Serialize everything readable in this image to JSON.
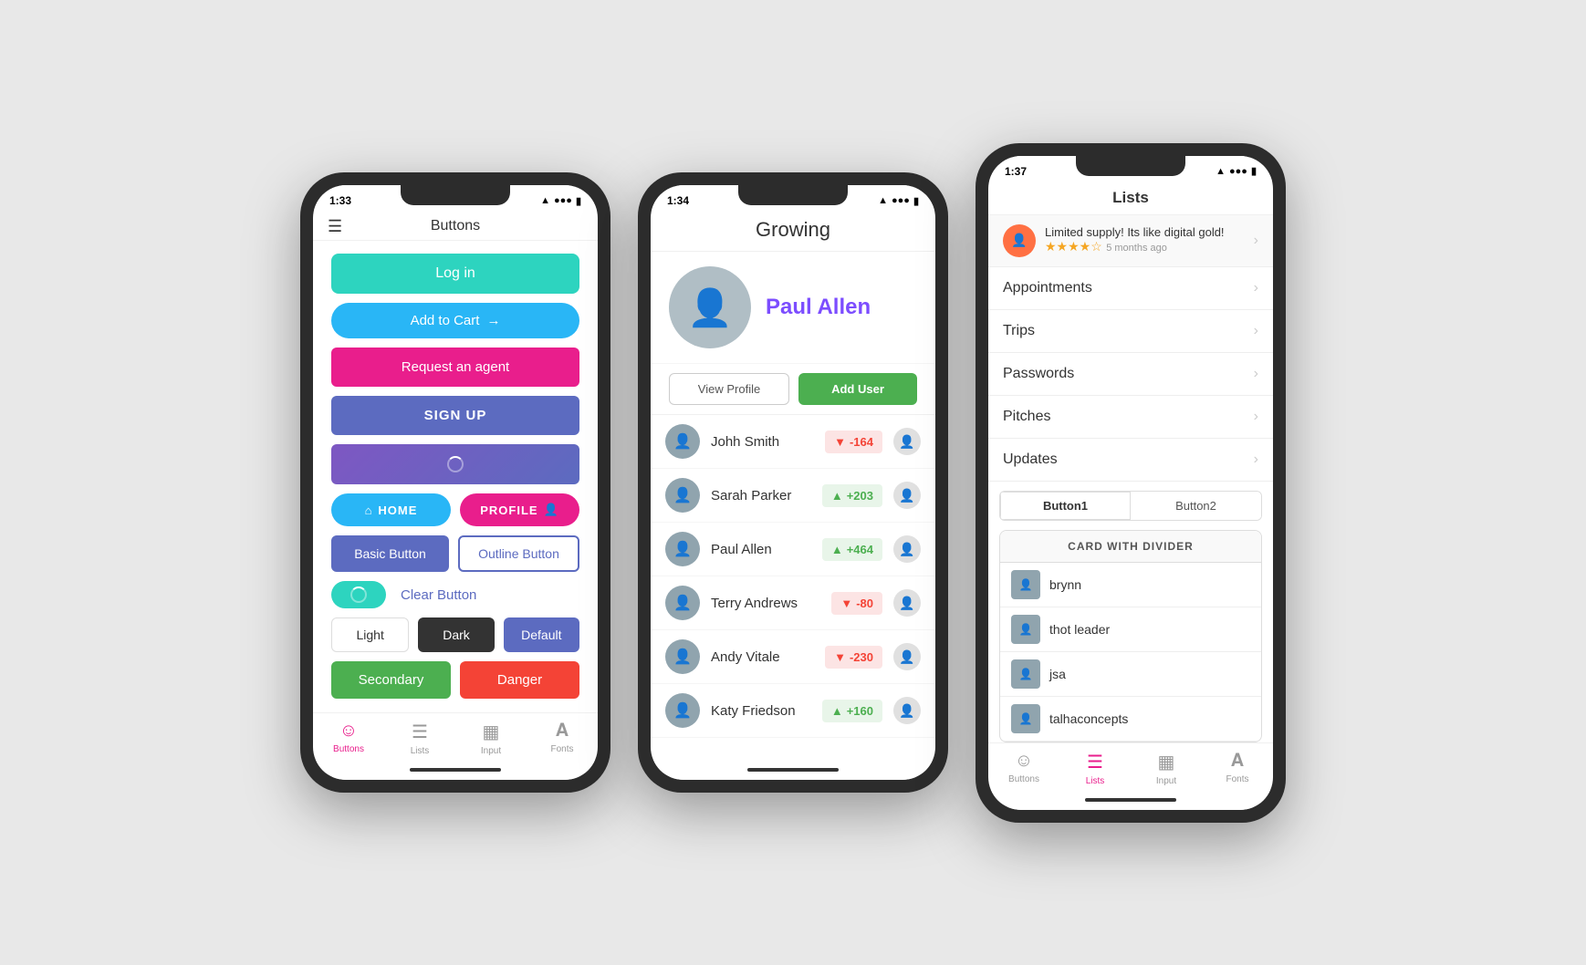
{
  "phone1": {
    "status_time": "1:33",
    "header_title": "Buttons",
    "buttons": {
      "login": "Log in",
      "add_to_cart": "Add to Cart",
      "request_agent": "Request an agent",
      "sign_up": "SIGN UP",
      "home": "HOME",
      "profile": "PROFILE",
      "basic": "Basic Button",
      "outline": "Outline Button",
      "clear": "Clear Button",
      "light": "Light",
      "dark": "Dark",
      "default": "Default",
      "secondary": "Secondary",
      "danger": "Danger"
    },
    "nav": {
      "buttons": "Buttons",
      "lists": "Lists",
      "input": "Input",
      "fonts": "Fonts"
    }
  },
  "phone2": {
    "status_time": "1:34",
    "header_title": "Growing",
    "profile_name": "Paul Allen",
    "view_profile_btn": "View Profile",
    "add_user_btn": "Add User",
    "users": [
      {
        "name": "Johh Smith",
        "score": "-164",
        "positive": false
      },
      {
        "name": "Sarah Parker",
        "score": "+203",
        "positive": true
      },
      {
        "name": "Paul Allen",
        "score": "+464",
        "positive": true
      },
      {
        "name": "Terry Andrews",
        "score": "-80",
        "positive": false
      },
      {
        "name": "Andy Vitale",
        "score": "-230",
        "positive": false
      },
      {
        "name": "Katy Friedson",
        "score": "+160",
        "positive": true
      }
    ]
  },
  "phone3": {
    "status_time": "1:37",
    "header_title": "Lists",
    "review": {
      "text": "Limited supply! Its like digital gold!",
      "stars": 4,
      "time": "5 months ago"
    },
    "list_items": [
      "Appointments",
      "Trips",
      "Passwords",
      "Pitches",
      "Updates"
    ],
    "tabs": [
      "Button1",
      "Button2"
    ],
    "card_header": "CARD WITH DIVIDER",
    "card_users": [
      "brynn",
      "thot leader",
      "jsa",
      "talhaconcepts"
    ],
    "nav": {
      "buttons": "Buttons",
      "lists": "Lists",
      "input": "Input",
      "fonts": "Fonts"
    }
  }
}
